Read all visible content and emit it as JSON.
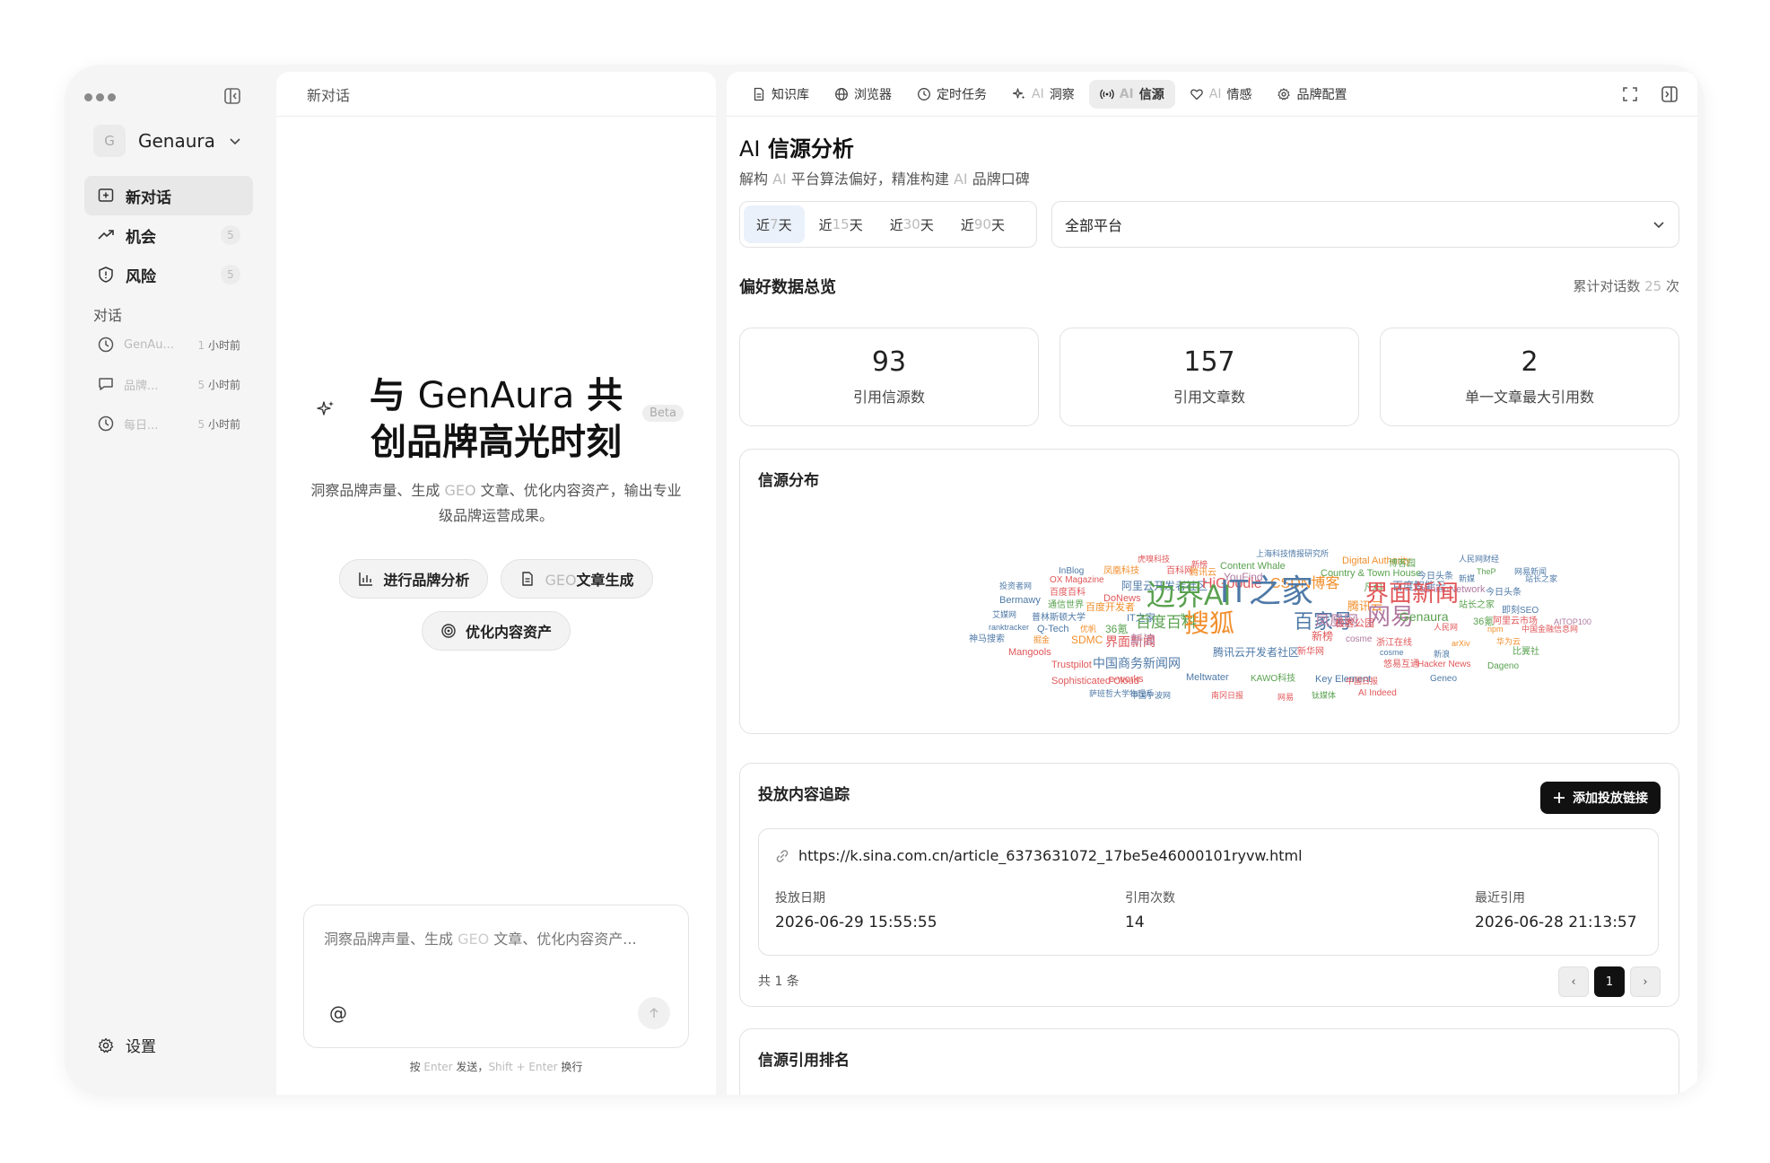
{
  "sidebar": {
    "workspace_initial": "G",
    "workspace_name": "Genaura",
    "nav": [
      {
        "label": "新对话",
        "icon": "new-chat-icon",
        "count": ""
      },
      {
        "label": "机会",
        "icon": "trend-up-icon",
        "count": "5"
      },
      {
        "label": "风险",
        "icon": "shield-icon",
        "count": "5"
      }
    ],
    "section_title": "对话",
    "conversations": [
      {
        "title": "GenAu...",
        "icon": "clock-icon",
        "time_num": "1",
        "time_unit": "小时前"
      },
      {
        "title": "品牌...",
        "icon": "chat-bubble-icon",
        "time_num": "5",
        "time_unit": "小时前"
      },
      {
        "title": "每日...",
        "icon": "clock-icon",
        "time_num": "5",
        "time_unit": "小时前"
      }
    ],
    "settings_label": "设置"
  },
  "chat": {
    "header": "新对话",
    "hero_line1_a": "与 ",
    "hero_line1_b": "GenAura",
    "hero_line1_c": " 共",
    "hero_line2": "创品牌高光时刻",
    "beta": "Beta",
    "sub_a": "洞察品牌声量、生成 ",
    "sub_geo": "GEO",
    "sub_b": " 文章、优化内容资产，输出专业级品牌运营成果。",
    "actions": {
      "brand_analysis": "进行品牌分析",
      "geo_prefix": "GEO",
      "geo_suffix": "文章生成",
      "optimize": "优化内容资产"
    },
    "composer_a": "洞察品牌声量、生成 ",
    "composer_geo": "GEO",
    "composer_b": " 文章、优化内容资产...",
    "at": "@",
    "hint_a": "按 ",
    "hint_enter": "Enter",
    "hint_b": " 发送，",
    "hint_shift": "Shift + Enter",
    "hint_c": " 换行"
  },
  "tabs": [
    {
      "prefix": "",
      "label": "知识库",
      "icon": "document-icon",
      "active": false
    },
    {
      "prefix": "",
      "label": "浏览器",
      "icon": "globe-icon",
      "active": false
    },
    {
      "prefix": "",
      "label": "定时任务",
      "icon": "clock-icon",
      "active": false
    },
    {
      "prefix": "AI",
      "label": "洞察",
      "icon": "sparkle-icon",
      "active": false
    },
    {
      "prefix": "AI",
      "label": "信源",
      "icon": "broadcast-icon",
      "active": true
    },
    {
      "prefix": "AI",
      "label": "情感",
      "icon": "heart-icon",
      "active": false
    },
    {
      "prefix": "",
      "label": "品牌配置",
      "icon": "gear-icon",
      "active": false
    }
  ],
  "page": {
    "title_ai": "AI",
    "title": "信源分析",
    "sub_a": "解构 ",
    "sub_ai1": "AI",
    "sub_b": " 平台算法偏好，精准构建 ",
    "sub_ai2": "AI",
    "sub_c": " 品牌口碑",
    "ranges": [
      {
        "a": "近 ",
        "n": "7",
        "b": " 天",
        "active": true
      },
      {
        "a": "近 ",
        "n": "15",
        "b": " 天",
        "active": false
      },
      {
        "a": "近 ",
        "n": "30",
        "b": " 天",
        "active": false
      },
      {
        "a": "近 ",
        "n": "90",
        "b": " 天",
        "active": false
      }
    ],
    "platform": "全部平台",
    "overview_title": "偏好数据总览",
    "total_a": "累计对话数 ",
    "total_n": "25",
    "total_b": " 次",
    "stats": [
      {
        "value": "93",
        "label": "引用信源数"
      },
      {
        "value": "157",
        "label": "引用文章数"
      },
      {
        "value": "2",
        "label": "单一文章最大引用数"
      }
    ],
    "cloud_title": "信源分布",
    "tracking_title": "投放内容追踪",
    "add_link": "添加投放链接",
    "url": "https://k.sina.com.cn/article_6373631072_17be5e46000101ryvw.html",
    "meta": [
      {
        "k": "投放日期",
        "v": "2026-06-29 15:55:55"
      },
      {
        "k": "引用次数",
        "v": "14"
      },
      {
        "k": "最近引用",
        "v": "2026-06-28 21:13:57"
      }
    ],
    "pager_count": "共 1 条",
    "pager_prev": "‹",
    "pager_current": "1",
    "pager_next": "›",
    "ranking_title": "信源引用排名"
  },
  "word_cloud": [
    {
      "t": "虎嗅科技",
      "c": "#e15759",
      "s": 9
    },
    {
      "t": "上海科技情报研究所",
      "c": "#4e79a7",
      "s": 9
    },
    {
      "t": "Digital Authority",
      "c": "#f28e2b",
      "s": 11
    },
    {
      "t": "人民网财经",
      "c": "#4e79a7",
      "s": 9
    },
    {
      "t": "新榜",
      "c": "#e15759",
      "s": 9
    },
    {
      "t": "Content Whale",
      "c": "#59a14f",
      "s": 11
    },
    {
      "t": "博客园",
      "c": "#59a14f",
      "s": 10
    },
    {
      "t": "InBlog",
      "c": "#4e79a7",
      "s": 10
    },
    {
      "t": "凤凰科技",
      "c": "#f28e2b",
      "s": 10
    },
    {
      "t": "百科网",
      "c": "#e15759",
      "s": 10
    },
    {
      "t": "腾讯云",
      "c": "#f28e2b",
      "s": 10
    },
    {
      "t": "Country & Town House",
      "c": "#59a14f",
      "s": 11
    },
    {
      "t": "TheP",
      "c": "#59a14f",
      "s": 9
    },
    {
      "t": "网易新闻",
      "c": "#4e79a7",
      "s": 9
    },
    {
      "t": "OX Magazine",
      "c": "#e15759",
      "s": 10
    },
    {
      "t": "YouFind",
      "c": "#b07aa1",
      "s": 12
    },
    {
      "t": "今日头条",
      "c": "#4e79a7",
      "s": 10
    },
    {
      "t": "新媒",
      "c": "#4e79a7",
      "s": 9
    },
    {
      "t": "站长之家",
      "c": "#4e79a7",
      "s": 9
    },
    {
      "t": "投资者网",
      "c": "#4e79a7",
      "s": 9
    },
    {
      "t": "阿里云开发者社区",
      "c": "#4e79a7",
      "s": 12
    },
    {
      "t": "HiGoodie",
      "c": "#e15759",
      "s": 16
    },
    {
      "t": "CSDN博客",
      "c": "#f28e2b",
      "s": 16
    },
    {
      "t": "凡科",
      "c": "#59a14f",
      "s": 11
    },
    {
      "t": "百度智能云",
      "c": "#4e79a7",
      "s": 12
    },
    {
      "t": "百度百科",
      "c": "#e15759",
      "s": 10
    },
    {
      "t": "FashionNetwork",
      "c": "#b07aa1",
      "s": 11
    },
    {
      "t": "今日头条",
      "c": "#4e79a7",
      "s": 10
    },
    {
      "t": "Bermawy",
      "c": "#4e79a7",
      "s": 11
    },
    {
      "t": "DoNews",
      "c": "#e15759",
      "s": 11
    },
    {
      "t": "边界AI",
      "c": "#59a14f",
      "s": 32
    },
    {
      "t": "IT之家",
      "c": "#4e79a7",
      "s": 36
    },
    {
      "t": "界面新闻",
      "c": "#e15759",
      "s": 26
    },
    {
      "t": "通信世界",
      "c": "#59a14f",
      "s": 10
    },
    {
      "t": "百度开发者",
      "c": "#f28e2b",
      "s": 11
    },
    {
      "t": "腾讯云",
      "c": "#f28e2b",
      "s": 13
    },
    {
      "t": "站长之家",
      "c": "#59a14f",
      "s": 10
    },
    {
      "t": "即刻SEO",
      "c": "#4e79a7",
      "s": 10
    },
    {
      "t": "艾媒网",
      "c": "#4e79a7",
      "s": 9
    },
    {
      "t": "普林斯顿大学",
      "c": "#4e79a7",
      "s": 10
    },
    {
      "t": "IT之家",
      "c": "#4e79a7",
      "s": 11
    },
    {
      "t": "fkw",
      "c": "#59a14f",
      "s": 9
    },
    {
      "t": "网易",
      "c": "#b07aa1",
      "s": 26
    },
    {
      "t": "Genaura",
      "c": "#59a14f",
      "s": 14
    },
    {
      "t": "36氪",
      "c": "#59a14f",
      "s": 11
    },
    {
      "t": "阿里云市场",
      "c": "#e15759",
      "s": 10
    },
    {
      "t": "AITOP100",
      "c": "#b07aa1",
      "s": 9
    },
    {
      "t": "ranktracker",
      "c": "#4e79a7",
      "s": 9
    },
    {
      "t": "Q-Tech",
      "c": "#4e79a7",
      "s": 11
    },
    {
      "t": "优帆",
      "c": "#f28e2b",
      "s": 9
    },
    {
      "t": "36氪",
      "c": "#59a14f",
      "s": 12
    },
    {
      "t": "百度百科",
      "c": "#59a14f",
      "s": 17
    },
    {
      "t": "搜狐",
      "c": "#f28e2b",
      "s": 28
    },
    {
      "t": "百家号",
      "c": "#4e79a7",
      "s": 22
    },
    {
      "t": "凤凰网",
      "c": "#b07aa1",
      "s": 16
    },
    {
      "t": "极客公园",
      "c": "#e15759",
      "s": 11
    },
    {
      "t": "人民网",
      "c": "#e15759",
      "s": 9
    },
    {
      "t": "npm",
      "c": "#f28e2b",
      "s": 9
    },
    {
      "t": "中国金融信息网",
      "c": "#e15759",
      "s": 9
    },
    {
      "t": "神马搜索",
      "c": "#4e79a7",
      "s": 10
    },
    {
      "t": "掘金",
      "c": "#f28e2b",
      "s": 9
    },
    {
      "t": "SDMC",
      "c": "#f28e2b",
      "s": 12
    },
    {
      "t": "界面新闻",
      "c": "#e15759",
      "s": 14
    },
    {
      "t": "新浪",
      "c": "#b07aa1",
      "s": 14
    },
    {
      "t": "新榜",
      "c": "#e15759",
      "s": 12
    },
    {
      "t": "cosme",
      "c": "#b07aa1",
      "s": 10
    },
    {
      "t": "浙江在线",
      "c": "#e15759",
      "s": 10
    },
    {
      "t": "arXiv",
      "c": "#f28e2b",
      "s": 9
    },
    {
      "t": "华为云",
      "c": "#f28e2b",
      "s": 9
    },
    {
      "t": "cosme",
      "c": "#4e79a7",
      "s": 9
    },
    {
      "t": "Mangools",
      "c": "#e15759",
      "s": 11
    },
    {
      "t": "新浪",
      "c": "#4e79a7",
      "s": 9
    },
    {
      "t": "比翼社",
      "c": "#59a14f",
      "s": 10
    },
    {
      "t": "Trustpilot",
      "c": "#e15759",
      "s": 11
    },
    {
      "t": "中国商务新闻网",
      "c": "#4e79a7",
      "s": 14
    },
    {
      "t": "腾讯云开发者社区",
      "c": "#4e79a7",
      "s": 12
    },
    {
      "t": "新华网",
      "c": "#e15759",
      "s": 10
    },
    {
      "t": "悠易互通",
      "c": "#e15759",
      "s": 10
    },
    {
      "t": "Hacker News",
      "c": "#e15759",
      "s": 10
    },
    {
      "t": "Dageno",
      "c": "#59a14f",
      "s": 10
    },
    {
      "t": "Sophisticated Cloud",
      "c": "#e15759",
      "s": 11
    },
    {
      "t": "e-works",
      "c": "#e15759",
      "s": 11
    },
    {
      "t": "Meltwater",
      "c": "#4e79a7",
      "s": 11
    },
    {
      "t": "KAWO科技",
      "c": "#59a14f",
      "s": 10
    },
    {
      "t": "Key Element",
      "c": "#4e79a7",
      "s": 11
    },
    {
      "t": "中国日报",
      "c": "#e15759",
      "s": 9
    },
    {
      "t": "Geneo",
      "c": "#4e79a7",
      "s": 10
    },
    {
      "t": "萨班哲大学物理系",
      "c": "#4e79a7",
      "s": 9
    },
    {
      "t": "中国宁波网",
      "c": "#4e79a7",
      "s": 9
    },
    {
      "t": "南冈日报",
      "c": "#e15759",
      "s": 9
    },
    {
      "t": "网易",
      "c": "#e15759",
      "s": 9
    },
    {
      "t": "钛媒体",
      "c": "#59a14f",
      "s": 9
    },
    {
      "t": "AI Indeed",
      "c": "#e15759",
      "s": 10
    }
  ]
}
